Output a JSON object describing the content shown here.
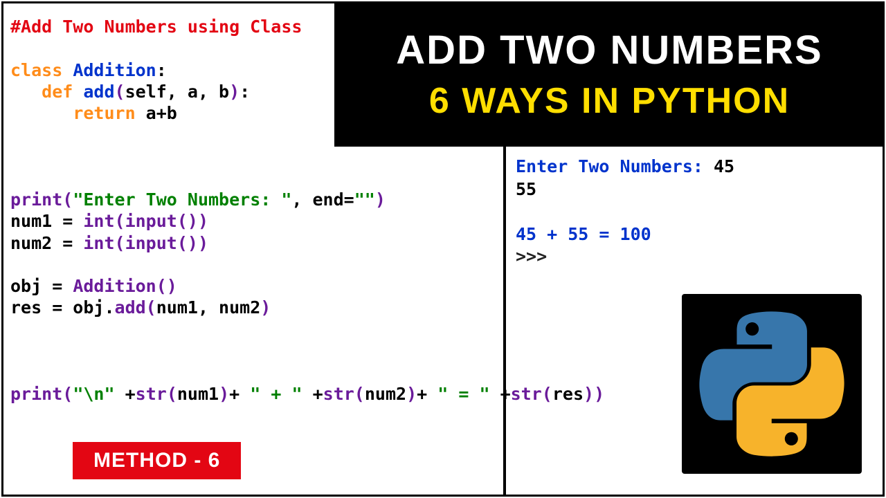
{
  "title": {
    "line1": "ADD TWO NUMBERS",
    "line2": "6 WAYS IN PYTHON"
  },
  "badge": "METHOD - 6",
  "code": {
    "comment": "#Add Two Numbers using Class",
    "class_kw": "class ",
    "class_name": "Addition",
    "colon": ":",
    "def_indent": "   ",
    "def_kw": "def ",
    "def_name": "add",
    "def_params_open": "(",
    "def_params": "self, a, b",
    "def_params_close": ")",
    "ret_indent": "      ",
    "ret_kw": "return ",
    "ret_expr": "a+b",
    "print1_fn": "print",
    "print1_open": "(",
    "print1_str": "\"Enter Two Numbers: \"",
    "print1_mid": ", end=",
    "print1_str2": "\"\"",
    "print1_close": ")",
    "num1_lhs": "num1 = ",
    "int_fn": "int",
    "input_fn": "input",
    "pp_open": "(",
    "pp_close": ")",
    "num2_lhs": "num2 = ",
    "obj_lhs": "obj = ",
    "addition_call": "Addition",
    "res_lhs": "res = obj.",
    "add_call": "add",
    "add_args_open": "(",
    "add_args": "num1, num2",
    "add_args_close": ")",
    "print2_fn": "print",
    "p2_open": "(",
    "p2_s1": "\"\\n\" ",
    "p2_plus1": "+",
    "p2_str1": "str",
    "p2_a1o": "(",
    "p2_a1": "num1",
    "p2_a1c": ")",
    "p2_plus2": "+ ",
    "p2_s2": "\" + \" ",
    "p2_plus3": "+",
    "p2_str2": "str",
    "p2_a2o": "(",
    "p2_a2": "num2",
    "p2_a2c": ")",
    "p2_plus4": "+ ",
    "p2_s3": "\" = \" ",
    "p2_plus5": "+",
    "p2_str3": "str",
    "p2_a3o": "(",
    "p2_a3": "res",
    "p2_a3c": ")",
    "p2_close": ")"
  },
  "output": {
    "line1a": "Enter Two Numbers: ",
    "line1b": "45",
    "line2": "55",
    "line3": "45 + 55 = 100",
    "prompt": ">>> "
  }
}
